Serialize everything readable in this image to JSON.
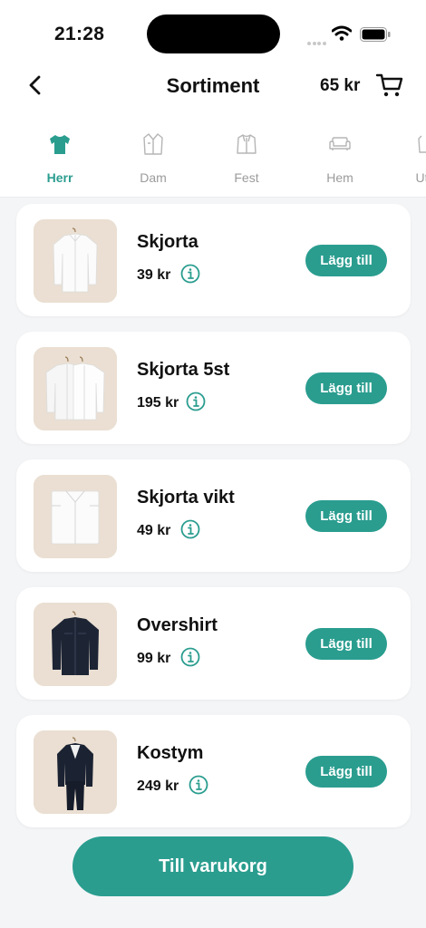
{
  "status_bar": {
    "time": "21:28"
  },
  "header": {
    "title": "Sortiment",
    "cart_total": "65 kr"
  },
  "categories": [
    {
      "label": "Herr",
      "icon": "tshirt-icon",
      "active": true
    },
    {
      "label": "Dam",
      "icon": "blouse-icon",
      "active": false
    },
    {
      "label": "Fest",
      "icon": "jacket-icon",
      "active": false
    },
    {
      "label": "Hem",
      "icon": "sofa-icon",
      "active": false
    },
    {
      "label": "Utc",
      "icon": "outdoor-icon",
      "active": false
    }
  ],
  "products": [
    {
      "name": "Skjorta",
      "price": "39 kr",
      "button": "Lägg till",
      "image": "white-shirt-on-hanger"
    },
    {
      "name": "Skjorta 5st",
      "price": "195 kr",
      "button": "Lägg till",
      "image": "two-white-shirts-on-hangers"
    },
    {
      "name": "Skjorta vikt",
      "price": "49 kr",
      "button": "Lägg till",
      "image": "folded-white-shirt"
    },
    {
      "name": "Overshirt",
      "price": "99 kr",
      "button": "Lägg till",
      "image": "navy-overshirt-on-hanger"
    },
    {
      "name": "Kostym",
      "price": "249 kr",
      "button": "Lägg till",
      "image": "navy-suit-on-hanger"
    }
  ],
  "checkout_label": "Till varukorg",
  "colors": {
    "accent": "#2a9d8f",
    "background": "#f4f5f7",
    "card": "#ffffff",
    "thumb_bg": "#e9dfd3"
  }
}
